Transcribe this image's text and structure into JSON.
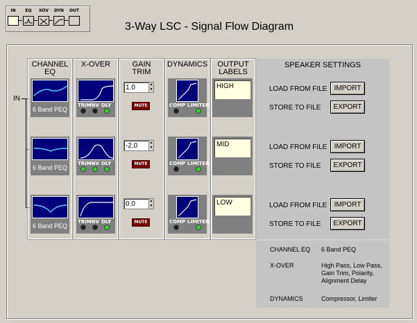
{
  "nav": {
    "items": [
      {
        "label": "IN"
      },
      {
        "label": "EQ"
      },
      {
        "label": "XOV"
      },
      {
        "label": "DYN"
      },
      {
        "label": "OUT"
      }
    ]
  },
  "title": "3-Way LSC - Signal Flow Diagram",
  "input_label": "IN",
  "columns": {
    "eq": "CHANNEL EQ",
    "xover": "X-OVER",
    "gain": "GAIN TRIM",
    "dynamics": "DYNAMICS",
    "output": "OUTPUT LABELS",
    "speaker": "SPEAKER SETTINGS"
  },
  "eq_label": "6 Band PEQ",
  "xover_leds": {
    "trim": "TRIM",
    "inv": "INV",
    "dly": "DLY"
  },
  "dyn_leds": {
    "comp": "COMP",
    "limiter": "LIMITER"
  },
  "mute_label": "MUTE",
  "channels": [
    {
      "gain": "1.0",
      "output_label": "HIGH",
      "xover_leds": [
        "off",
        "off",
        "on"
      ],
      "dyn_leds": [
        "off",
        "on"
      ]
    },
    {
      "gain": "-2.0",
      "output_label": "MID",
      "xover_leds": [
        "on",
        "on",
        "on"
      ],
      "dyn_leds": [
        "off",
        "on"
      ]
    },
    {
      "gain": "0.0",
      "output_label": "LOW",
      "xover_leds": [
        "off",
        "off",
        "on"
      ],
      "dyn_leds": [
        "off",
        "on"
      ]
    }
  ],
  "speaker": {
    "load_label": "LOAD FROM FILE",
    "store_label": "STORE TO FILE",
    "import_label": "IMPORT",
    "export_label": "EXPORT"
  },
  "legend": {
    "eq_key": "CHANNEL EQ",
    "eq_val": "6 Band PEQ",
    "xover_key": "X-OVER",
    "xover_val_1": "High Pass, Low Pass,",
    "xover_val_2": "Gain Trim, Polarity,",
    "xover_val_3": "Alignment Delay",
    "dyn_key": "DYNAMICS",
    "dyn_val": "Compressor, Limiter"
  },
  "colors": {
    "screen": "#00007a",
    "led_on": "#2fd42f",
    "mute": "#7a0000",
    "label_bg": "#ffffe1"
  }
}
